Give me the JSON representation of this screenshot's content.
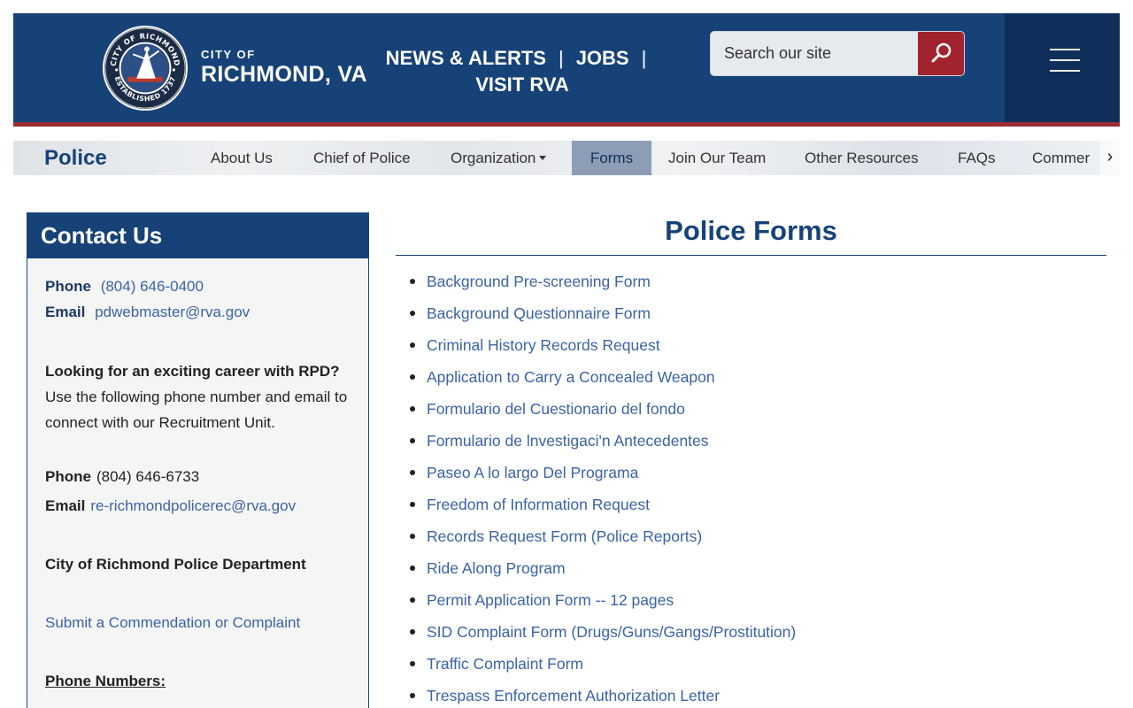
{
  "header": {
    "city_of": "CITY OF",
    "city_name": "RICHMOND, VA",
    "seal": {
      "top_text": "CITY OF RICHMOND",
      "bottom_text": "ESTABLISHED 1737"
    },
    "links": [
      "NEWS & ALERTS",
      "JOBS",
      "VISIT RVA"
    ],
    "separator": "|",
    "search_placeholder": "Search our site",
    "colors": {
      "primary": "#164278",
      "accent": "#9b2b34",
      "search_button": "#a0232d",
      "menu_block": "#0f2f5a"
    }
  },
  "subnav": {
    "title": "Police",
    "items": [
      "About Us",
      "Chief of Police",
      "Organization",
      "Forms",
      "Join Our Team",
      "Other Resources",
      "FAQs",
      "Commer"
    ],
    "active": "Forms",
    "next_icon": "›"
  },
  "sidebar": {
    "title": "Contact Us",
    "phone_label": "Phone",
    "phone": "(804) 646-0400",
    "email_label": "Email",
    "email": "pdwebmaster@rva.gov",
    "career_heading": "Looking for an exciting career with RPD?",
    "career_text": "Use the following phone number and email to connect with our Recruitment Unit.",
    "rec_phone_label": "Phone",
    "rec_phone": "(804) 646-6733",
    "rec_email_label": "Email",
    "rec_email": "re-richmondpolicerec@rva.gov",
    "department": "City of Richmond Police Department",
    "commendation_link": "Submit a Commendation or Complaint",
    "phone_numbers_heading": "Phone Numbers:"
  },
  "main": {
    "title": "Police Forms",
    "forms": [
      "Background Pre-screening Form",
      "Background Questionnaire Form",
      "Criminal History Records Request",
      "Application to Carry a Concealed Weapon",
      "Formulario del Cuestionario del fondo",
      "Formulario de lnvestigaci'n Antecedentes",
      "Paseo A lo largo Del Programa",
      "Freedom of Information Request",
      "Records Request Form (Police Reports)",
      "Ride Along Program",
      "Permit Application Form -- 12 pages",
      "SID Complaint Form (Drugs/Guns/Gangs/Prostitution)",
      "Traffic Complaint Form",
      "Trespass Enforcement Authorization Letter"
    ]
  }
}
